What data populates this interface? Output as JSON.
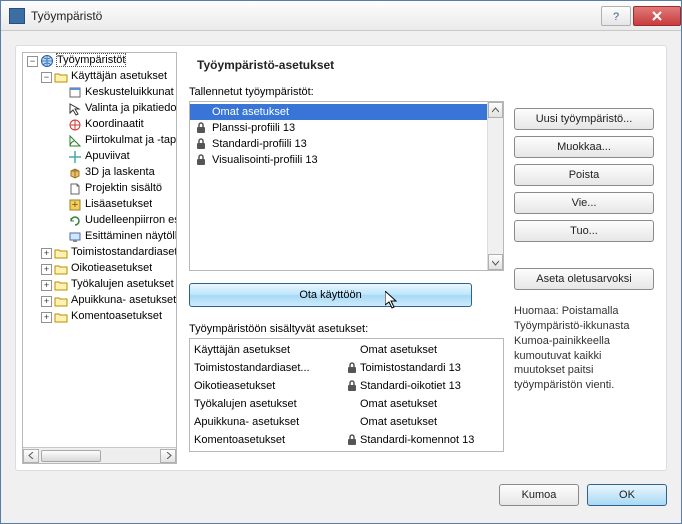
{
  "window": {
    "title": "Työympäristö"
  },
  "tree": {
    "root": "Työympäristöt",
    "nodes": [
      {
        "label": "Käyttäjän asetukset",
        "exp": "-",
        "indent": 2
      },
      {
        "label": "Keskusteluikkunat",
        "indent": 3,
        "icon": "dialog"
      },
      {
        "label": "Valinta ja pikatiedot",
        "indent": 3,
        "icon": "select"
      },
      {
        "label": "Koordinaatit",
        "indent": 3,
        "icon": "coord"
      },
      {
        "label": "Piirtokulmat ja -tapat",
        "indent": 3,
        "icon": "angle"
      },
      {
        "label": "Apuviivat",
        "indent": 3,
        "icon": "guide"
      },
      {
        "label": "3D ja laskenta",
        "indent": 3,
        "icon": "cube"
      },
      {
        "label": "Projektin sisältö",
        "indent": 3,
        "icon": "file"
      },
      {
        "label": "Lisäasetukset",
        "indent": 3,
        "icon": "more"
      },
      {
        "label": "Uudelleenpiirron es",
        "indent": 3,
        "icon": "redraw"
      },
      {
        "label": "Esittäminen näytöllä",
        "indent": 3,
        "icon": "display"
      },
      {
        "label": "Toimistostandardiaset",
        "exp": "+",
        "indent": 2
      },
      {
        "label": "Oikotieasetukset",
        "exp": "+",
        "indent": 2
      },
      {
        "label": "Työkalujen asetukset",
        "exp": "+",
        "indent": 2
      },
      {
        "label": "Apuikkuna- asetukset",
        "exp": "+",
        "indent": 2
      },
      {
        "label": "Komentoasetukset",
        "exp": "+",
        "indent": 2
      }
    ]
  },
  "content": {
    "title": "Työympäristö-asetukset",
    "stored_label": "Tallennetut työympäristöt:",
    "stored": [
      {
        "name": "Omat asetukset",
        "locked": false,
        "selected": true
      },
      {
        "name": "Planssi-profiili 13",
        "locked": true
      },
      {
        "name": "Standardi-profiili 13",
        "locked": true
      },
      {
        "name": "Visualisointi-profiili 13",
        "locked": true
      }
    ],
    "buttons": {
      "new": "Uusi työympäristö...",
      "edit": "Muokkaa...",
      "delete": "Poista",
      "export": "Vie...",
      "import": "Tuo...",
      "reset": "Aseta oletusarvoksi"
    },
    "note": "Huomaa: Poistamalla Työympäristö-ikkunasta Kumoa-painikkeella kumoutuvat kaikki muutokset paitsi työympäristön vienti.",
    "apply": "Ota käyttöön",
    "settings_label": "Työympäristöön sisältyvät asetukset:",
    "settings": [
      {
        "k": "Käyttäjän asetukset",
        "locked": false,
        "v": "Omat asetukset"
      },
      {
        "k": "Toimistostandardiaset...",
        "locked": true,
        "v": "Toimistostandardi 13"
      },
      {
        "k": "Oikotieasetukset",
        "locked": true,
        "v": "Standardi-oikotiet 13"
      },
      {
        "k": "Työkalujen asetukset",
        "locked": false,
        "v": "Omat asetukset"
      },
      {
        "k": "Apuikkuna- asetukset",
        "locked": false,
        "v": "Omat asetukset"
      },
      {
        "k": "Komentoasetukset",
        "locked": true,
        "v": "Standardi-komennot 13"
      }
    ]
  },
  "footer": {
    "cancel": "Kumoa",
    "ok": "OK"
  }
}
